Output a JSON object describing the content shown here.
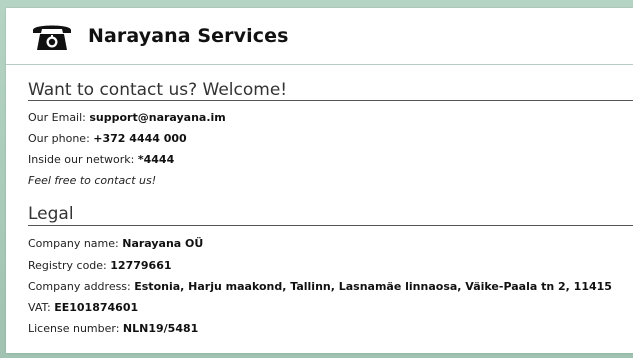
{
  "header": {
    "title": "Narayana Services",
    "logo_icon": "telephone-icon"
  },
  "contact": {
    "title": "Want to contact us? Welcome!",
    "email_label": "Our Email:",
    "email_value": "support@narayana.im",
    "phone_label": "Our phone:",
    "phone_value": "+372 4444 000",
    "network_label": "Inside our network:",
    "network_value": "*4444",
    "note": "Feel free to contact us!"
  },
  "legal": {
    "title": "Legal",
    "company_name_label": "Company name:",
    "company_name_value": "Narayana OÜ",
    "registry_label": "Registry code:",
    "registry_value": "12779661",
    "address_label": "Company address:",
    "address_value": "Estonia, Harju maakond, Tallinn, Lasnamäe linnaosa, Väike-Paala tn 2, 11415",
    "vat_label": "VAT:",
    "vat_value": "EE101874601",
    "license_label": "License number:",
    "license_value": "NLN19/5481"
  },
  "colors": {
    "background": "#a9c9b8",
    "panel": "#ffffff",
    "text": "#222222"
  }
}
